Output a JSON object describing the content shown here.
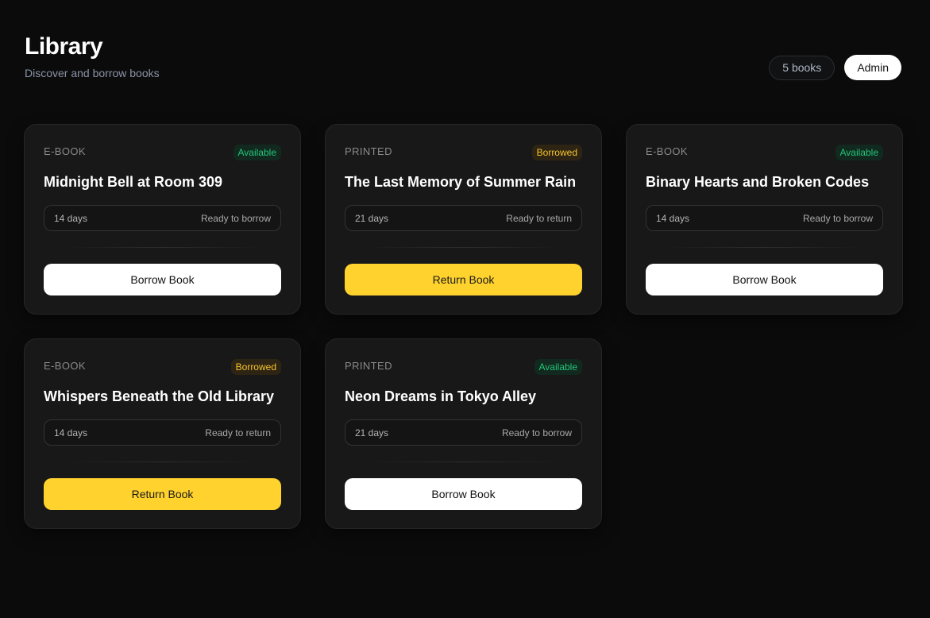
{
  "header": {
    "title": "Library",
    "subtitle": "Discover and borrow books",
    "count_label": "5 books",
    "role_button": "Admin"
  },
  "books": [
    {
      "type": "E-BOOK",
      "status": "Available",
      "title": "Midnight Bell at Room 309",
      "days": "14 days",
      "state": "Ready to borrow",
      "action": "Borrow Book"
    },
    {
      "type": "PRINTED",
      "status": "Borrowed",
      "title": "The Last Memory of Summer Rain",
      "days": "21 days",
      "state": "Ready to return",
      "action": "Return Book"
    },
    {
      "type": "E-BOOK",
      "status": "Available",
      "title": "Binary Hearts and Broken Codes",
      "days": "14 days",
      "state": "Ready to borrow",
      "action": "Borrow Book"
    },
    {
      "type": "E-BOOK",
      "status": "Borrowed",
      "title": "Whispers Beneath the Old Library",
      "days": "14 days",
      "state": "Ready to return",
      "action": "Return Book"
    },
    {
      "type": "PRINTED",
      "status": "Available",
      "title": "Neon Dreams in Tokyo Alley",
      "days": "21 days",
      "state": "Ready to borrow",
      "action": "Borrow Book"
    }
  ],
  "colors": {
    "available": "#22c77a",
    "borrowed": "#f8c62c",
    "return_button": "#ffd22e",
    "background": "#0b0b0b"
  }
}
